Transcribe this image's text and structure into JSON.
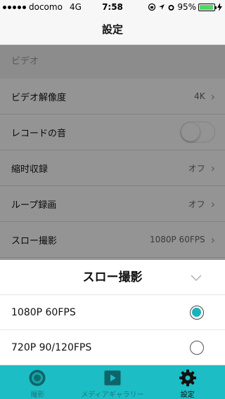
{
  "status_bar": {
    "carrier": "docomo",
    "network": "4G",
    "time": "7:58",
    "battery_percent": "95%",
    "battery_level": 0.95,
    "icons": [
      "orientation-lock-icon",
      "location-icon",
      "alarm-icon",
      "charging-icon"
    ]
  },
  "nav": {
    "title": "設定"
  },
  "settings": {
    "section_title": "ビデオ",
    "rows": [
      {
        "label": "ビデオ解像度",
        "value": "4K"
      },
      {
        "label": "レコードの音",
        "toggle_on": false
      },
      {
        "label": "縮时収録",
        "value": "オフ"
      },
      {
        "label": "ループ録画",
        "value": "オフ"
      },
      {
        "label": "スロー撮影",
        "value": "1080P 60FPS"
      }
    ]
  },
  "sheet": {
    "title": "スロー撮影",
    "options": [
      {
        "label": "1080P 60FPS",
        "selected": true
      },
      {
        "label": "720P 90/120FPS",
        "selected": false
      }
    ]
  },
  "tabs": [
    {
      "label": "撮影",
      "icon": "camera-icon",
      "active": false
    },
    {
      "label": "メディアギャラリー",
      "icon": "play-icon",
      "active": false
    },
    {
      "label": "設定",
      "icon": "gear-icon",
      "active": true
    }
  ],
  "colors": {
    "accent": "#1cbdc4",
    "radio_selected": "#1ab2bc",
    "battery": "#4cd964"
  }
}
